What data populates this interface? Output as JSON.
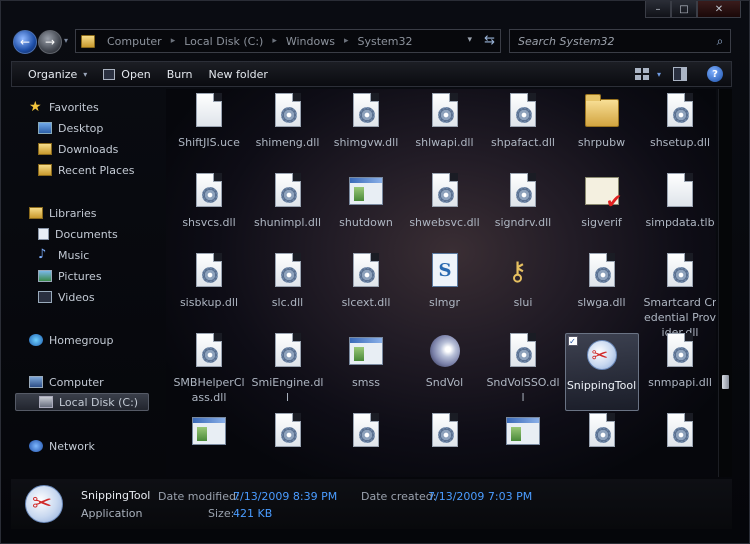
{
  "window": {
    "caption": {
      "minimize": "–",
      "maximize": "□",
      "close": "✕"
    }
  },
  "nav": {
    "back": "←",
    "forward": "→",
    "recent": "▾"
  },
  "address": {
    "crumbs": [
      "Computer",
      "Local Disk (C:)",
      "Windows",
      "System32"
    ],
    "separator": "▸",
    "dropdown": "▾",
    "refresh": "⇆"
  },
  "search": {
    "placeholder": "Search System32",
    "icon": "⌕"
  },
  "toolbar": {
    "organize": "Organize",
    "organize_caret": "▾",
    "open": "Open",
    "burn": "Burn",
    "new_folder": "New folder",
    "view_caret": "▾",
    "help": "?"
  },
  "navpane": {
    "favorites": "Favorites",
    "desktop": "Desktop",
    "downloads": "Downloads",
    "recent_places": "Recent Places",
    "libraries": "Libraries",
    "documents": "Documents",
    "music": "Music",
    "pictures": "Pictures",
    "videos": "Videos",
    "homegroup": "Homegroup",
    "computer": "Computer",
    "local_disk": "Local Disk (C:)",
    "network": "Network"
  },
  "files": [
    {
      "name": "ShiftJIS.uce",
      "icon": "document-icon"
    },
    {
      "name": "shimeng.dll",
      "icon": "dll-gear-icon"
    },
    {
      "name": "shimgvw.dll",
      "icon": "dll-gear-icon"
    },
    {
      "name": "shlwapi.dll",
      "icon": "dll-gear-icon"
    },
    {
      "name": "shpafact.dll",
      "icon": "dll-gear-icon"
    },
    {
      "name": "shrpubw",
      "icon": "folder-users-icon"
    },
    {
      "name": "shsetup.dll",
      "icon": "dll-gear-icon"
    },
    {
      "name": "shsvcs.dll",
      "icon": "dll-gear-icon"
    },
    {
      "name": "shunimpl.dll",
      "icon": "dll-gear-icon"
    },
    {
      "name": "shutdown",
      "icon": "application-window-icon"
    },
    {
      "name": "shwebsvc.dll",
      "icon": "dll-gear-icon"
    },
    {
      "name": "signdrv.dll",
      "icon": "dll-gear-icon"
    },
    {
      "name": "sigverif",
      "icon": "certificate-check-icon"
    },
    {
      "name": "simpdata.tlb",
      "icon": "document-icon"
    },
    {
      "name": "sisbkup.dll",
      "icon": "dll-gear-icon"
    },
    {
      "name": "slc.dll",
      "icon": "dll-gear-icon"
    },
    {
      "name": "slcext.dll",
      "icon": "dll-gear-icon"
    },
    {
      "name": "slmgr",
      "icon": "script-icon"
    },
    {
      "name": "slui",
      "icon": "keys-icon"
    },
    {
      "name": "slwga.dll",
      "icon": "dll-gear-icon"
    },
    {
      "name": "Smartcard Credential Provider.dll",
      "icon": "dll-gear-icon"
    },
    {
      "name": "SMBHelperClass.dll",
      "icon": "dll-gear-icon"
    },
    {
      "name": "SmiEngine.dll",
      "icon": "dll-gear-icon"
    },
    {
      "name": "smss",
      "icon": "application-window-icon"
    },
    {
      "name": "SndVol",
      "icon": "speaker-icon"
    },
    {
      "name": "SndVolSSO.dll",
      "icon": "dll-gear-icon"
    },
    {
      "name": "SnippingTool",
      "icon": "scissors-icon",
      "selected": true
    },
    {
      "name": "snmpapi.dll",
      "icon": "dll-gear-icon"
    },
    {
      "name": "",
      "icon": "application-window-icon"
    },
    {
      "name": "",
      "icon": "dll-gear-icon"
    },
    {
      "name": "",
      "icon": "dll-gear-icon"
    },
    {
      "name": "",
      "icon": "dll-gear-icon"
    },
    {
      "name": "",
      "icon": "application-window-icon"
    },
    {
      "name": "",
      "icon": "dll-gear-icon"
    },
    {
      "name": "",
      "icon": "dll-gear-icon"
    }
  ],
  "details": {
    "name": "SnippingTool",
    "type": "Application",
    "modified_label": "Date modified:",
    "modified_value": "7/13/2009 8:39 PM",
    "created_label": "Date created:",
    "created_value": "7/13/2009 7:03 PM",
    "size_label": "Size:",
    "size_value": "421 KB"
  }
}
